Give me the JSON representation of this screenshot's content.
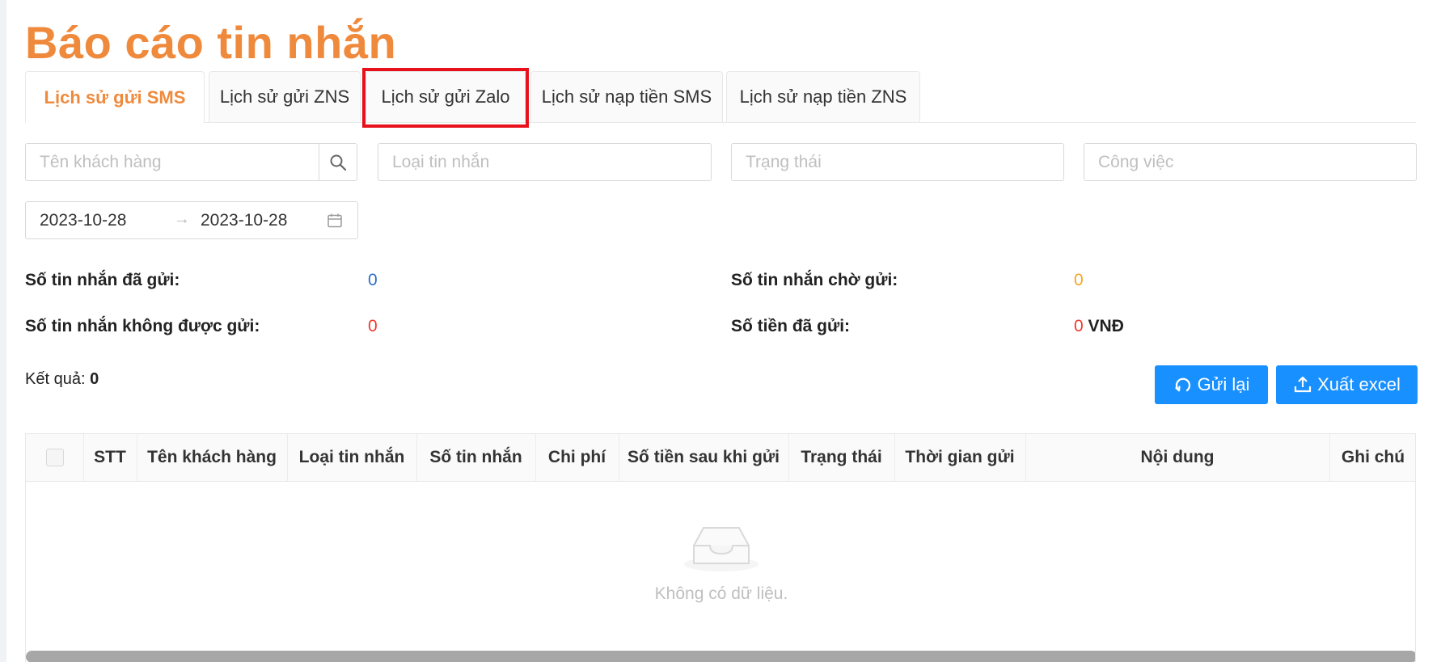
{
  "page": {
    "title": "Báo cáo tin nhắn"
  },
  "tabs": [
    {
      "label": "Lịch sử gửi SMS",
      "active": true
    },
    {
      "label": "Lịch sử gửi ZNS",
      "active": false
    },
    {
      "label": "Lịch sử gửi Zalo",
      "active": false,
      "highlighted": true
    },
    {
      "label": "Lịch sử nạp tiền SMS",
      "active": false
    },
    {
      "label": "Lịch sử nạp tiền ZNS",
      "active": false
    }
  ],
  "filters": {
    "customer_placeholder": "Tên khách hàng",
    "message_type_placeholder": "Loại tin nhắn",
    "status_placeholder": "Trạng thái",
    "job_placeholder": "Công việc",
    "date_from": "2023-10-28",
    "date_to": "2023-10-28",
    "date_separator": "→"
  },
  "stats": {
    "sent_label": "Số tin nhắn đã gửi:",
    "sent_value": "0",
    "pending_label": "Số tin nhắn chờ gửi:",
    "pending_value": "0",
    "failed_label": "Số tin nhắn không được gửi:",
    "failed_value": "0",
    "amount_label": "Số tiền đã gửi:",
    "amount_value": "0",
    "amount_unit": "VNĐ"
  },
  "results": {
    "label": "Kết quả:",
    "count": "0"
  },
  "actions": {
    "resend_label": "Gửi lại",
    "export_label": "Xuất excel"
  },
  "table": {
    "columns": [
      "STT",
      "Tên khách hàng",
      "Loại tin nhắn",
      "Số tin nhắn",
      "Chi phí",
      "Số tiền sau khi gửi",
      "Trạng thái",
      "Thời gian gửi",
      "Nội dung",
      "Ghi chú"
    ],
    "rows": [],
    "empty_text": "Không có dữ liệu."
  },
  "colors": {
    "accent": "#ef8a3d",
    "primary": "#1890ff",
    "highlight": "#e8101a"
  }
}
